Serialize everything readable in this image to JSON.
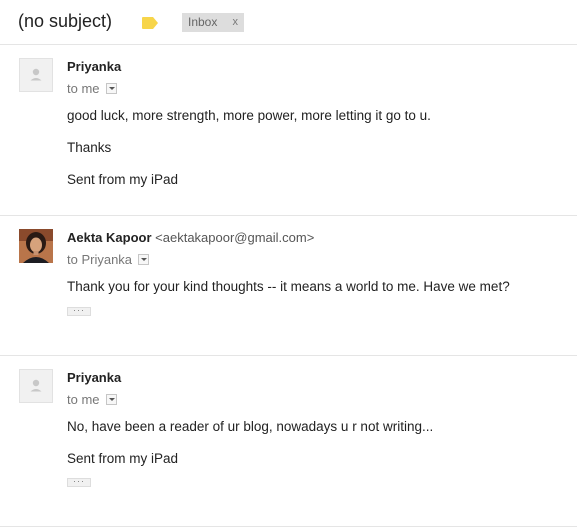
{
  "subject": "(no subject)",
  "label_icon": "label-tag-icon",
  "label_color": "#f7d54a",
  "inbox_chip": {
    "label": "Inbox",
    "remove": "x"
  },
  "messages": [
    {
      "sender": "Priyanka",
      "sender_email": "",
      "recipient": "to me",
      "avatar": "default-person-icon",
      "body": [
        "good luck, more strength, more power, more letting it go to u.",
        "Thanks",
        "Sent from my iPad"
      ]
    },
    {
      "sender": "Aekta Kapoor",
      "sender_email": "<aektakapoor@gmail.com>",
      "recipient": "to Priyanka",
      "avatar": "profile-photo",
      "body": [
        "Thank you for your kind thoughts -- it means a world to me. Have we met?"
      ],
      "quoted_toggle": "···"
    },
    {
      "sender": "Priyanka",
      "sender_email": "",
      "recipient": "to me",
      "avatar": "default-person-icon",
      "body": [
        "No, have been a reader of ur blog, nowadays u r not writing...",
        "Sent from my iPad"
      ],
      "quoted_toggle": "···"
    }
  ]
}
